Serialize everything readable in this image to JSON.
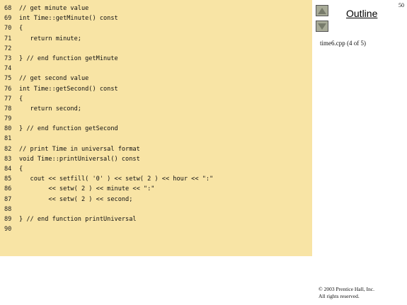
{
  "slide_number": "50",
  "outline": {
    "label": "Outline",
    "file": "time6.cpp (4 of 5)"
  },
  "code_lines": [
    {
      "n": "68",
      "text": "// get minute value"
    },
    {
      "n": "69",
      "text": "int Time::getMinute() const"
    },
    {
      "n": "70",
      "text": "{"
    },
    {
      "n": "71",
      "text": "   return minute;"
    },
    {
      "n": "72",
      "text": ""
    },
    {
      "n": "73",
      "text": "} // end function getMinute"
    },
    {
      "n": "74",
      "text": ""
    },
    {
      "n": "75",
      "text": "// get second value"
    },
    {
      "n": "76",
      "text": "int Time::getSecond() const"
    },
    {
      "n": "77",
      "text": "{"
    },
    {
      "n": "78",
      "text": "   return second;"
    },
    {
      "n": "79",
      "text": ""
    },
    {
      "n": "80",
      "text": "} // end function getSecond"
    },
    {
      "n": "81",
      "text": ""
    },
    {
      "n": "82",
      "text": "// print Time in universal format"
    },
    {
      "n": "83",
      "text": "void Time::printUniversal() const"
    },
    {
      "n": "84",
      "text": "{"
    },
    {
      "n": "85",
      "text": "   cout << setfill( '0' ) << setw( 2 ) << hour << \":\""
    },
    {
      "n": "86",
      "text": "        << setw( 2 ) << minute << \":\""
    },
    {
      "n": "87",
      "text": "        << setw( 2 ) << second;"
    },
    {
      "n": "88",
      "text": ""
    },
    {
      "n": "89",
      "text": "} // end function printUniversal"
    },
    {
      "n": "90",
      "text": ""
    }
  ],
  "copyright": {
    "line1": "© 2003 Prentice Hall, Inc.",
    "line2": "All rights reserved."
  },
  "colors": {
    "code_background": "#f8e4a5",
    "nav_button": "#a8ab98"
  },
  "icons": {
    "previous": "triangle-up-icon",
    "next": "triangle-down-icon"
  }
}
